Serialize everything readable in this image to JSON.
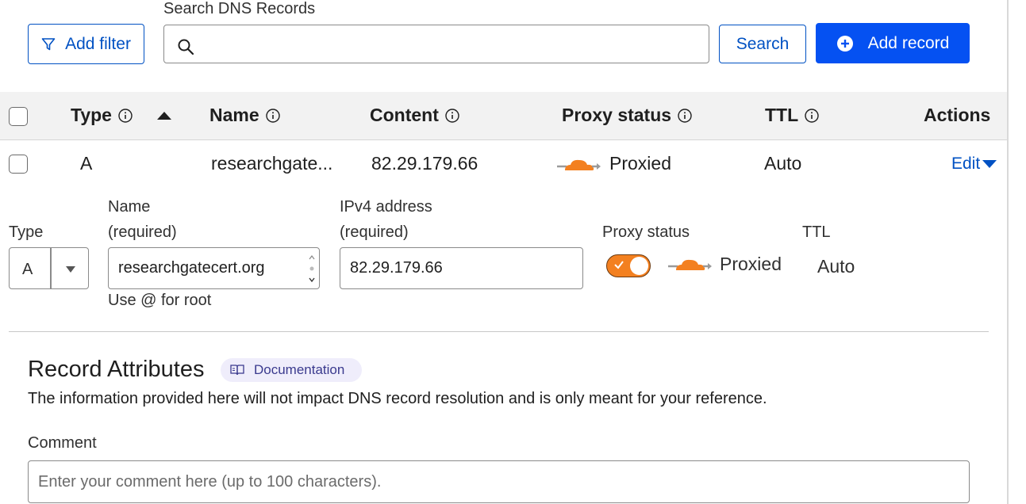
{
  "toolbar": {
    "add_filter_label": "Add filter",
    "search_label": "Search DNS Records",
    "search_placeholder": "",
    "search_button_label": "Search",
    "add_record_label": "Add record"
  },
  "table": {
    "headers": {
      "type": "Type",
      "name": "Name",
      "content": "Content",
      "proxy_status": "Proxy status",
      "ttl": "TTL",
      "actions": "Actions"
    },
    "rows": [
      {
        "type": "A",
        "name": "researchgate...",
        "content": "82.29.179.66",
        "proxy_status": "Proxied",
        "ttl": "Auto",
        "action_label": "Edit"
      }
    ]
  },
  "edit_form": {
    "type_label": "Type",
    "type_value": "A",
    "name_label_line1": "Name",
    "name_label_line2": "(required)",
    "name_value": "researchgatecert.org",
    "name_help": "Use @ for root",
    "ipv4_label_line1": "IPv4 address",
    "ipv4_label_line2": "(required)",
    "ipv4_value": "82.29.179.66",
    "proxy_label": "Proxy status",
    "proxy_value": "Proxied",
    "proxy_enabled": true,
    "ttl_label": "TTL",
    "ttl_value": "Auto"
  },
  "record_attributes": {
    "title": "Record Attributes",
    "doc_badge": "Documentation",
    "description": "The information provided here will not impact DNS record resolution and is only meant for your reference.",
    "comment_label": "Comment",
    "comment_placeholder": "Enter your comment here (up to 100 characters)."
  },
  "colors": {
    "primary_blue": "#0551f2",
    "link_blue": "#0051c3",
    "cloud_orange": "#f38020",
    "badge_bg": "#efedfb"
  },
  "icons": [
    "filter-icon",
    "search-icon",
    "plus-circle-icon",
    "info-icon",
    "sort-up-icon",
    "cloud-proxied-icon",
    "caret-down-icon",
    "book-icon",
    "check-icon"
  ]
}
